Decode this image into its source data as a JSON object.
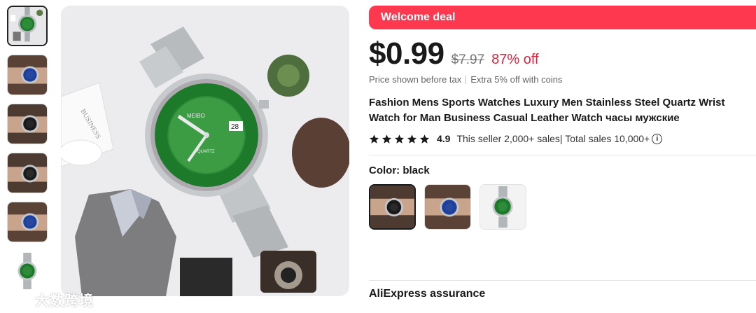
{
  "thumbnails": [
    {
      "name": "green-watch-flatlay",
      "dial": "#2e8b3a",
      "bezel": "#1c7a2a",
      "active": true
    },
    {
      "name": "blue-watch-wrist",
      "dial": "#1f3f9c",
      "bezel": "#1f3f9c",
      "active": false
    },
    {
      "name": "black-watch-wrist",
      "dial": "#1a1a1a",
      "bezel": "#1a1a1a",
      "active": false
    },
    {
      "name": "black-watch-wrist-2",
      "dial": "#1a1a1a",
      "bezel": "#1a1a1a",
      "active": false
    },
    {
      "name": "blue-watch-wrist-2",
      "dial": "#1f3f9c",
      "bezel": "#1f3f9c",
      "active": false
    },
    {
      "name": "green-watch-standing",
      "dial": "#2e8b3a",
      "bezel": "#1c7a2a",
      "active": false
    }
  ],
  "main_image": {
    "watch_brand": "MEIBO",
    "dial_text": "QUARTZ",
    "date": "28",
    "paper_text": "BUSINESS"
  },
  "watermark": {
    "text": "大数跨境"
  },
  "deal": {
    "label": "Welcome deal",
    "color": "#fd384f"
  },
  "price": {
    "current": "$0.99",
    "original": "$7.97",
    "discount": "87% off",
    "tax_note": "Price shown before tax",
    "coins_note": "Extra 5% off with coins"
  },
  "product": {
    "title": "Fashion Mens Sports Watches Luxury Men Stainless Steel Quartz Wrist Watch for Man Business Casual Leather Watch часы мужские",
    "rating": "4.9",
    "sales": "This seller 2,000+ sales| Total sales 10,000+",
    "info_icon": "i"
  },
  "color": {
    "label": "Color: black",
    "options": [
      {
        "name": "black",
        "dial": "#1a1a1a",
        "selected": true
      },
      {
        "name": "blue",
        "dial": "#1f3f9c",
        "selected": false
      },
      {
        "name": "green",
        "dial": "#2e8b3a",
        "selected": false
      }
    ]
  },
  "assurance": {
    "label": "AliExpress assurance"
  },
  "colors": {
    "accent": "#fd384f",
    "discount": "#e0243e",
    "text": "#191919"
  }
}
